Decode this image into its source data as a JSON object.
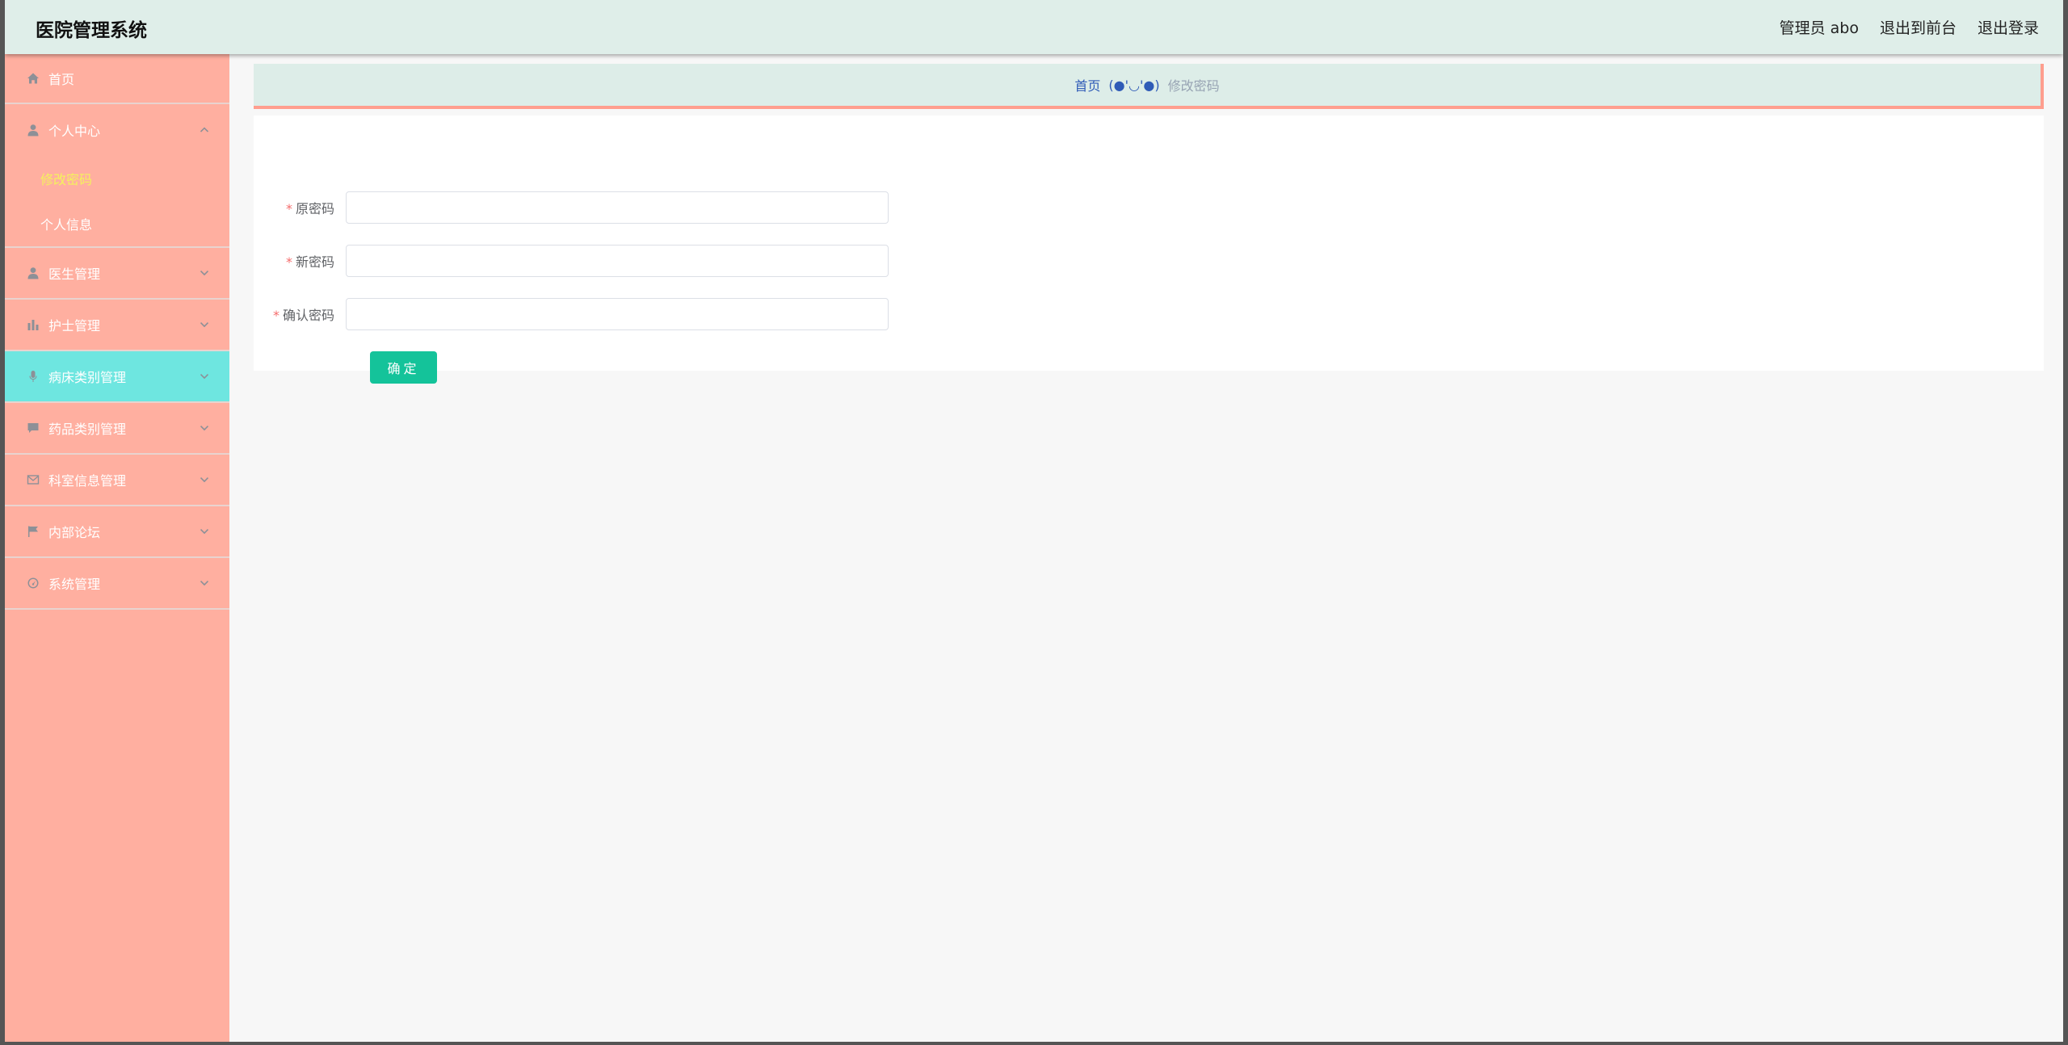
{
  "header": {
    "title": "医院管理系统",
    "user": "管理员 abo",
    "to_front": "退出到前台",
    "logout": "退出登录"
  },
  "sidebar": {
    "items": [
      {
        "label": "首页",
        "icon": "home-icon"
      },
      {
        "label": "个人中心",
        "icon": "user-icon",
        "expanded": true,
        "children": [
          {
            "label": "修改密码",
            "current": true
          },
          {
            "label": "个人信息"
          }
        ]
      },
      {
        "label": "医生管理",
        "icon": "user-icon"
      },
      {
        "label": "护士管理",
        "icon": "bar-chart-icon"
      },
      {
        "label": "病床类别管理",
        "icon": "microphone-icon",
        "active": true
      },
      {
        "label": "药品类别管理",
        "icon": "chat-icon"
      },
      {
        "label": "科室信息管理",
        "icon": "mail-icon"
      },
      {
        "label": "内部论坛",
        "icon": "flag-icon"
      },
      {
        "label": "系统管理",
        "icon": "gauge-icon"
      }
    ]
  },
  "breadcrumb": {
    "home": "首页",
    "separator": "(●'◡'●)",
    "current": "修改密码"
  },
  "form": {
    "old_password_label": "原密码",
    "new_password_label": "新密码",
    "confirm_password_label": "确认密码",
    "required_mark": "*",
    "submit_label": "确定"
  },
  "colors": {
    "sidebar_bg": "#ffafa0",
    "sidebar_active": "#6ee6e0",
    "header_bg": "#dfeee9",
    "submit_button": "#14c39a",
    "current_submenu_text": "#f4f25c"
  }
}
